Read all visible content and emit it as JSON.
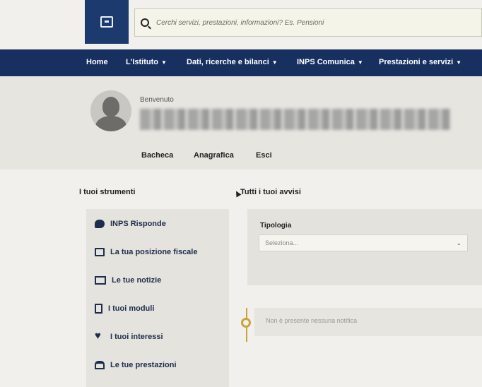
{
  "search": {
    "placeholder": "Cerchi servizi, prestazioni, informazioni? Es. Pensioni"
  },
  "nav": {
    "items": [
      {
        "label": "Home",
        "has_dropdown": false
      },
      {
        "label": "L'Istituto",
        "has_dropdown": true
      },
      {
        "label": "Dati, ricerche e bilanci",
        "has_dropdown": true
      },
      {
        "label": "INPS Comunica",
        "has_dropdown": true
      },
      {
        "label": "Prestazioni e servizi",
        "has_dropdown": true
      }
    ]
  },
  "profile": {
    "welcome": "Benvenuto",
    "tabs": [
      "Bacheca",
      "Anagrafica",
      "Esci"
    ]
  },
  "tools": {
    "title": "I tuoi strumenti",
    "items": [
      {
        "label": "INPS Risponde",
        "icon": "chat-icon"
      },
      {
        "label": "La tua posizione fiscale",
        "icon": "document-icon"
      },
      {
        "label": "Le tue notizie",
        "icon": "news-icon"
      },
      {
        "label": "I tuoi moduli",
        "icon": "form-icon"
      },
      {
        "label": "I tuoi interessi",
        "icon": "heart-icon"
      },
      {
        "label": "Le tue prestazioni",
        "icon": "tray-icon"
      }
    ]
  },
  "notices": {
    "title": "Tutti i tuoi avvisi",
    "filter_label": "Tipologia",
    "select_value": "Seleziona...",
    "empty_message": "Non è presente nessuna notifica"
  },
  "colors": {
    "nav_bg": "#17305f",
    "logo_bg": "#1d3a6e",
    "accent_timeline": "#c8a53c"
  }
}
